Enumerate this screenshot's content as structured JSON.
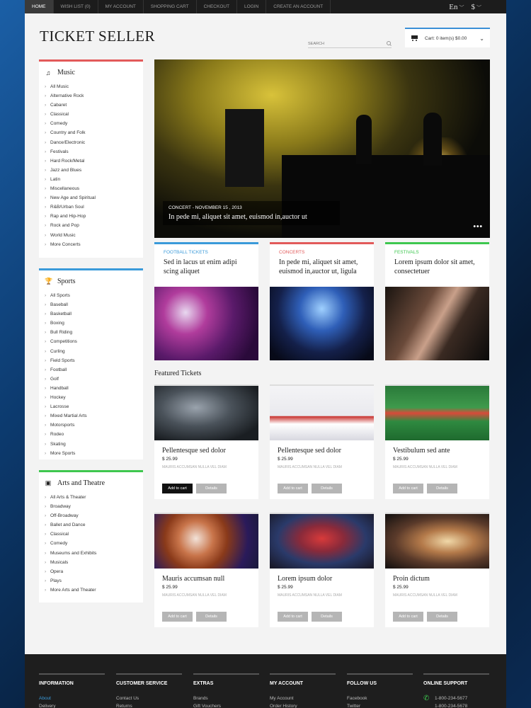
{
  "topnav": {
    "items": [
      "HOME",
      "WISH LIST (0)",
      "MY ACCOUNT",
      "SHOPPING CART",
      "CHECKOUT",
      "LOGIN",
      "CREATE AN ACCOUNT"
    ],
    "language": "En",
    "currency": "$"
  },
  "header": {
    "logo": "TICKET SELLER",
    "search_placeholder": "SEARCH",
    "cart_label": "Cart: 0 item(s) $0.00"
  },
  "sidebar": {
    "music": {
      "title": "Music",
      "items": [
        "All Music",
        "Alternative Rock",
        "Cabaret",
        "Classical",
        "Comedy",
        "Country and Folk",
        "Dance/Electronic",
        "Festivals",
        "Hard Rock/Metal",
        "Jazz and Blues",
        "Latin",
        "Miscellaneous",
        "New Age and Spiritual",
        "R&B/Urban Soul",
        "Rap and Hip-Hop",
        "Rock and Pop",
        "World Music",
        "More Concerts"
      ]
    },
    "sports": {
      "title": "Sports",
      "items": [
        "All Sports",
        "Baseball",
        "Basketball",
        "Boxing",
        "Bull Riding",
        "Competitions",
        "Curling",
        "Field Sports",
        "Football",
        "Golf",
        "Handball",
        "Hockey",
        "Lacrosse",
        "Mixed Martial Arts",
        "Motorsports",
        "Rodeo",
        "Skating",
        "More Sports"
      ]
    },
    "arts": {
      "title": "Arts and Theatre",
      "items": [
        "All Arts & Theater",
        "Broadway",
        "Off-Broadway",
        "Ballet and Dance",
        "Classical",
        "Comedy",
        "Museums and Exhibits",
        "Musicals",
        "Opera",
        "Plays",
        "More Arts and Theater"
      ]
    }
  },
  "hero": {
    "category": "CONCERT - NOVEMBER 15 , 2013",
    "text": "In pede mi, aliquet sit amet, euismod in,auctor ut"
  },
  "categories": [
    {
      "label": "FOOTBALL TICKETS",
      "text": "Sed in lacus ut enim adipi scing aliquet",
      "color": "#3a9ad9"
    },
    {
      "label": "CONCERTS",
      "text": "In pede mi, aliquet sit amet, euismod in,auctor ut, ligula",
      "color": "#e25a5a"
    },
    {
      "label": "FESTIVALS",
      "text": "Lorem ipsum dolor sit amet, consectetuer",
      "color": "#3ec74f"
    }
  ],
  "featured_title": "Featured Tickets",
  "products": [
    {
      "name": "Pellentesque sed dolor",
      "price": "$ 25.99",
      "desc": "MAURIS ACCUMSAN NULLA VEL DIAM",
      "add": "Add to cart",
      "details": "Details"
    },
    {
      "name": "Pellentesque sed dolor",
      "price": "$ 25.99",
      "desc": "MAURIS ACCUMSAN NULLA VEL DIAM",
      "add": "Add to cart",
      "details": "Details"
    },
    {
      "name": "Vestibulum sed ante",
      "price": "$ 25.99",
      "desc": "MAURIS ACCUMSAN NULLA VEL DIAM",
      "add": "Add to cart",
      "details": "Details"
    },
    {
      "name": "Mauris accumsan null",
      "price": "$ 25.99",
      "desc": "MAURIS ACCUMSAN NULLA VEL DIAM",
      "add": "Add to cart",
      "details": "Details"
    },
    {
      "name": "Lorem ipsum dolor",
      "price": "$ 25.99",
      "desc": "MAURIS ACCUMSAN NULLA VEL DIAM",
      "add": "Add to cart",
      "details": "Details"
    },
    {
      "name": "Proin dictum",
      "price": "$ 25.99",
      "desc": "MAURIS ACCUMSAN NULLA VEL DIAM",
      "add": "Add to cart",
      "details": "Details"
    }
  ],
  "footer": {
    "columns": [
      {
        "title": "INFORMATION",
        "items": [
          "About",
          "Delivery"
        ]
      },
      {
        "title": "CUSTOMER SERVICE",
        "items": [
          "Contact Us",
          "Returns"
        ]
      },
      {
        "title": "EXTRAS",
        "items": [
          "Brands",
          "Gift Vouchers"
        ]
      },
      {
        "title": "MY ACCOUNT",
        "items": [
          "My Account",
          "Order History"
        ]
      },
      {
        "title": "FOLLOW US",
        "items": [
          "Facebook",
          "Twitter"
        ]
      },
      {
        "title": "ONLINE SUPPORT",
        "items": [
          "1-800-234-5677",
          "1-800-234-5678"
        ]
      }
    ]
  }
}
